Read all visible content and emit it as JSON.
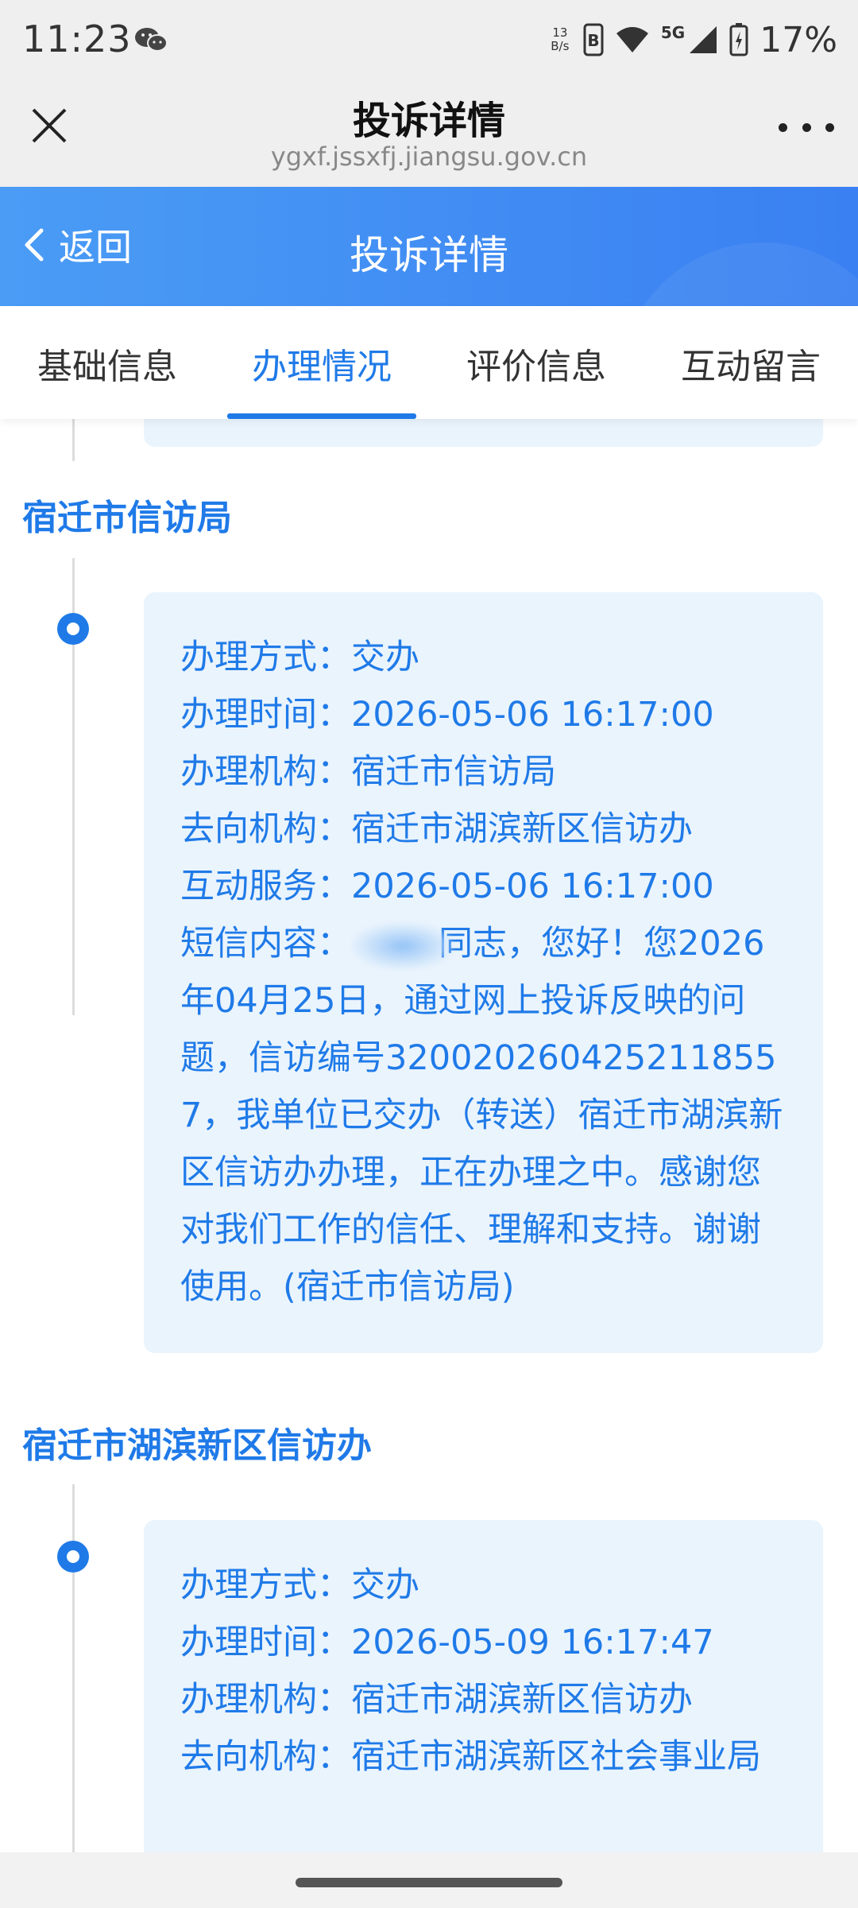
{
  "status_bar": {
    "time": "11:23",
    "net_speed_value": "13",
    "net_speed_unit": "B/s",
    "network": "5G",
    "battery": "17%"
  },
  "browser": {
    "title": "投诉详情",
    "url": "ygxf.jssxfj.jiangsu.gov.cn"
  },
  "header": {
    "back_label": "返回",
    "title": "投诉详情"
  },
  "tabs": [
    {
      "label": "基础信息",
      "active": false
    },
    {
      "label": "办理情况",
      "active": true
    },
    {
      "label": "评价信息",
      "active": false
    },
    {
      "label": "互动留言",
      "active": false
    }
  ],
  "records": [
    {
      "department": "宿迁市信访局",
      "rows": [
        {
          "label": "办理方式：",
          "value": "交办"
        },
        {
          "label": "办理时间：",
          "value": "2026-05-06 16:17:00"
        },
        {
          "label": "办理机构：",
          "value": "宿迁市信访局"
        },
        {
          "label": "去向机构：",
          "value": "宿迁市湖滨新区信访办"
        },
        {
          "label": "互动服务：",
          "value": "2026-05-06 16:17:00"
        }
      ],
      "sms_label": "短信内容：",
      "sms_text": "同志，您好！您2026年04月25日，通过网上投诉反映的问题，信访编号3200202604252118557，我单位已交办（转送）宿迁市湖滨新区信访办办理，正在办理之中。感谢您对我们工作的信任、理解和支持。谢谢使用。(宿迁市信访局)"
    },
    {
      "department": "宿迁市湖滨新区信访办",
      "rows": [
        {
          "label": "办理方式：",
          "value": "交办"
        },
        {
          "label": "办理时间：",
          "value": "2026-05-09 16:17:47"
        },
        {
          "label": "办理机构：",
          "value": "宿迁市湖滨新区信访办"
        },
        {
          "label": "去向机构：",
          "value": "宿迁市湖滨新区社会事业局"
        }
      ]
    }
  ],
  "colors": {
    "accent": "#1f7ae8",
    "header_gradient_start": "#4a9cf5",
    "header_gradient_end": "#3a80f2",
    "card_bg": "#eaf4fd"
  },
  "icons": [
    "wechat-icon",
    "signal-icon",
    "wifi-icon",
    "battery-icon",
    "close-icon",
    "more-icon",
    "back-chevron-icon"
  ]
}
